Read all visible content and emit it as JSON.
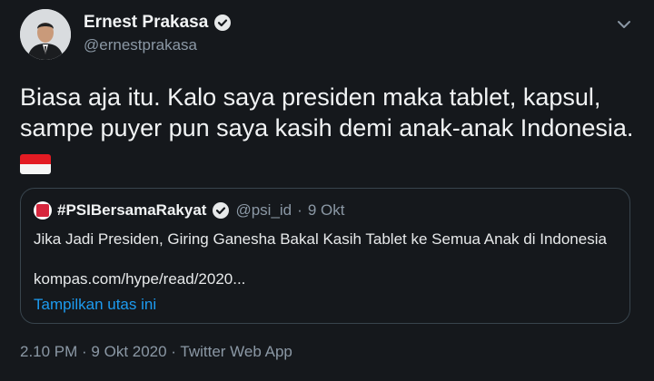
{
  "author": {
    "name": "Ernest Prakasa",
    "handle": "@ernestprakasa"
  },
  "tweet": {
    "line1": "Biasa aja itu. Kalo saya presiden maka tablet, kapsul,",
    "line2": "sampe puyer pun saya kasih demi anak-anak Indonesia."
  },
  "quoted": {
    "name": "#PSIBersamaRakyat",
    "handle": "@psi_id",
    "separator": "·",
    "date": "9 Okt",
    "text": "Jika Jadi Presiden, Giring Ganesha Bakal Kasih Tablet ke Semua Anak di Indonesia",
    "link": "kompas.com/hype/read/2020...",
    "show_thread": "Tampilkan utas ini"
  },
  "meta": {
    "timestamp": "2.10 PM · 9 Okt 2020 · Twitter Web App"
  },
  "colors": {
    "background": "#15181c",
    "verified": "#e7e9ea",
    "link_blue": "#1d9bf0",
    "flag_red": "#e31b23"
  },
  "icons": {
    "verified": "verified-badge-icon",
    "caret": "chevron-down-icon",
    "flag": "indonesia-flag-emoji"
  }
}
